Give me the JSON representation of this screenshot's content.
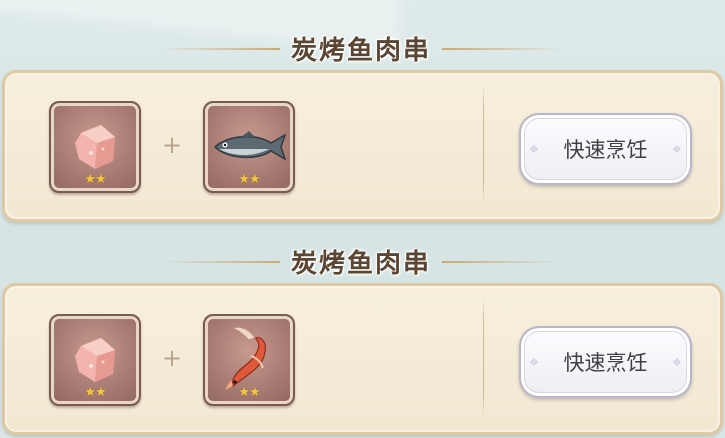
{
  "recipes": [
    {
      "title": "炭烤鱼肉串",
      "ingredients": [
        {
          "name": "raw-meat",
          "stars": "★★"
        },
        {
          "name": "fish",
          "stars": "★★"
        }
      ],
      "plus": "+",
      "button_label": "快速烹饪"
    },
    {
      "title": "炭烤鱼肉串",
      "ingredients": [
        {
          "name": "raw-meat",
          "stars": "★★"
        },
        {
          "name": "koi-fish",
          "stars": "★★"
        }
      ],
      "plus": "+",
      "button_label": "快速烹饪"
    }
  ],
  "colors": {
    "panel_bg": "#f4ebd6",
    "slot_bg": "#a57a72",
    "star": "#f3c640",
    "title": "#5a4632"
  }
}
